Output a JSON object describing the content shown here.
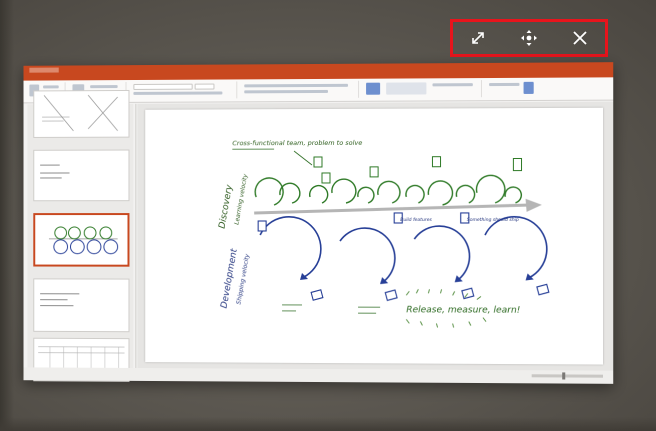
{
  "window_controls": {
    "expand_icon": "expand-icon",
    "move_icon": "move-icon",
    "close_icon": "close-icon",
    "highlight_color": "#e8141c"
  },
  "app": {
    "name": "PowerPoint",
    "accent_color": "#c8481f"
  },
  "slide": {
    "annotation_top": "Cross-functional team, problem to solve",
    "label_discovery": "Discovery",
    "label_discovery_sub": "Learning velocity",
    "label_development": "Development",
    "label_development_sub": "Shipping velocity",
    "note_a": "Build features",
    "note_b": "Something should ship",
    "footer": "Release, measure, learn!"
  }
}
